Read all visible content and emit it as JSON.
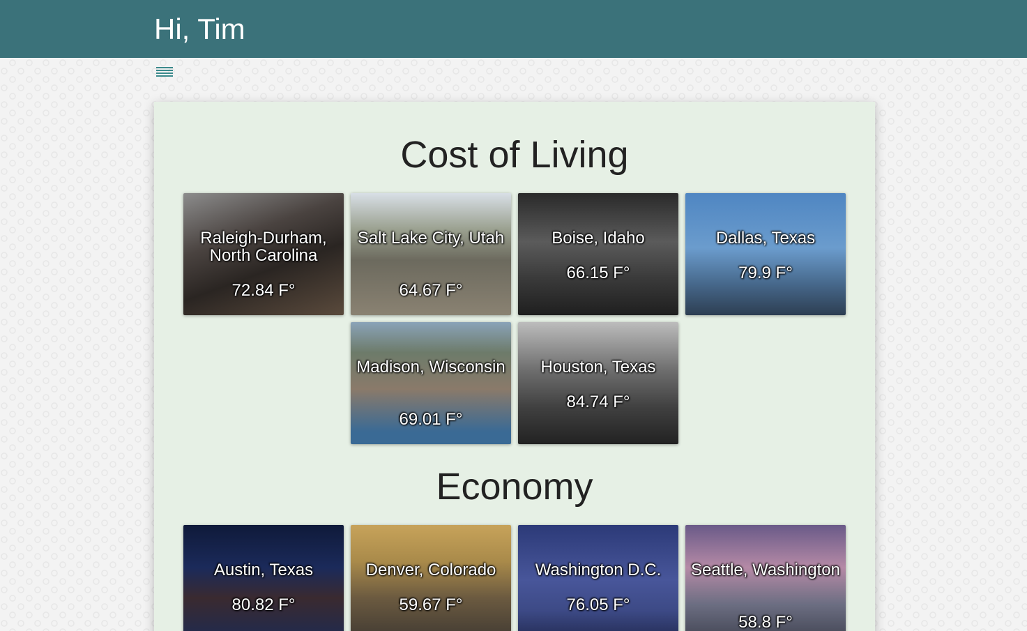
{
  "header": {
    "greeting": "Hi, Tim"
  },
  "colors": {
    "header_bg": "#3b727a",
    "panel_bg": "#e6f0e5",
    "menu_icon": "#3b8a8c"
  },
  "sections": [
    {
      "title": "Cost of Living",
      "cities": [
        {
          "name": "Raleigh-Durham, North Carolina",
          "temp": "72.84 F°"
        },
        {
          "name": "Salt Lake City, Utah",
          "temp": "64.67 F°"
        },
        {
          "name": "Boise, Idaho",
          "temp": "66.15 F°"
        },
        {
          "name": "Dallas, Texas",
          "temp": "79.9 F°"
        },
        {
          "name": "Madison, Wisconsin",
          "temp": "69.01 F°"
        },
        {
          "name": "Houston, Texas",
          "temp": "84.74 F°"
        }
      ]
    },
    {
      "title": "Economy",
      "cities": [
        {
          "name": "Austin, Texas",
          "temp": "80.82 F°"
        },
        {
          "name": "Denver, Colorado",
          "temp": "59.67 F°"
        },
        {
          "name": "Washington D.C.",
          "temp": "76.05 F°"
        },
        {
          "name": "Seattle, Washington",
          "temp": "58.8 F°"
        }
      ]
    }
  ]
}
